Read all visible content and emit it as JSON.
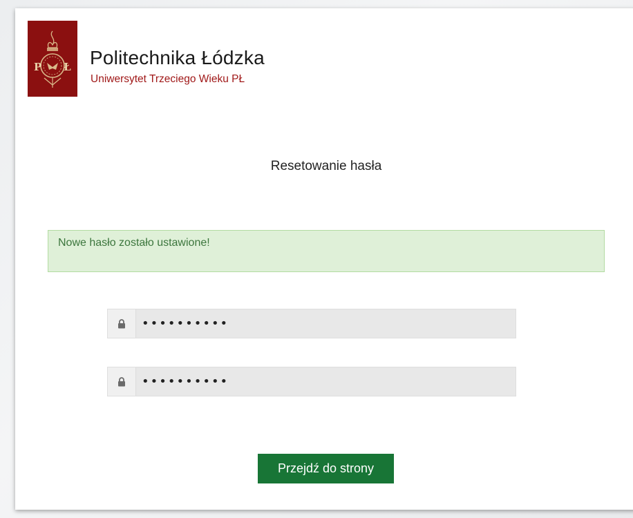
{
  "brand": {
    "name": "Politechnika Łódzka",
    "subtitle": "Uniwersytet Trzeciego Wieku PŁ",
    "logo_icon": "pl-crest-icon",
    "logo_color": "#8b1010"
  },
  "page": {
    "title": "Resetowanie hasła"
  },
  "alert": {
    "message": "Nowe hasło zostało ustawione!",
    "background": "#dff0d8",
    "text_color": "#3c763d"
  },
  "form": {
    "password": {
      "icon": "lock-icon",
      "value": "••••••••••"
    },
    "password_confirm": {
      "icon": "lock-icon",
      "value": "••••••••••"
    }
  },
  "actions": {
    "go_label": "Przejdź do strony",
    "go_color": "#187536"
  }
}
